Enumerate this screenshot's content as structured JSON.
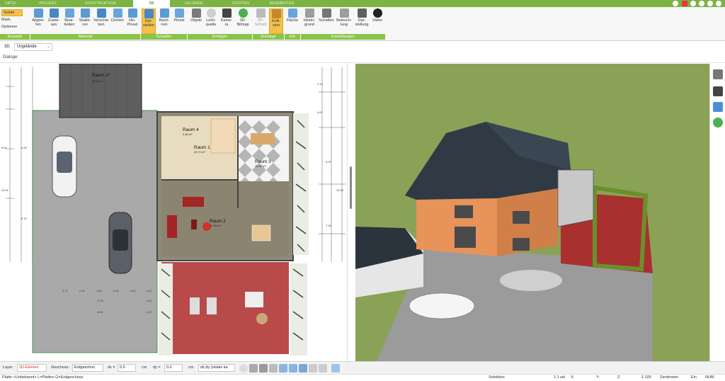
{
  "tabs": [
    {
      "label": "DATEI",
      "active": false
    },
    {
      "label": "PROJEKT",
      "active": false
    },
    {
      "label": "KONSTRUKTION",
      "active": false
    },
    {
      "label": "3D",
      "active": true
    },
    {
      "label": "GELÄNDE",
      "active": false
    },
    {
      "label": "SICHTEN",
      "active": false
    },
    {
      "label": "BEARBEITEN",
      "active": false
    }
  ],
  "ribbon": {
    "selection": {
      "select": "Selekt",
      "mark": "Mark.",
      "options": "Optionen"
    },
    "buttons": {
      "abgreifen": "Abgrei-\nfen",
      "zuweisen": "Zuwei-\nsen",
      "bearbeiten": "Bear-\nbeiten",
      "skalieren": "Skalie-\nren",
      "verschieben": "Verschie-\nben",
      "drehen": "Drehen",
      "hinpinsel": "Hin.\nPinsel",
      "darstellen": "Dar-\nstellen",
      "rechnen": "Rech-\nnen",
      "pinsel": "Pinsel",
      "objekt": "Objekt",
      "lichtquelle": "Licht-\nquelle",
      "kamera": "Kame-\nra",
      "bitmap": "3D-\nBitmap",
      "schnitt": "3D-\nSchnitt",
      "kollision": "Kolli-\nsion",
      "flaeche": "Fläche",
      "hintergrund": "Hinter-\ngrund",
      "schatten": "Schatten",
      "beleuchtung": "Beleuch-\ntung",
      "darstellung": "Dar-\nstellung",
      "video": "Video"
    },
    "groups": {
      "auswahl": "Auswahl",
      "material": "Material",
      "schatten": "Schatten",
      "einfuegen": "Einfügen",
      "sonstige": "Sonstige",
      "info": "Info",
      "einstellungen": "Einstellungen"
    }
  },
  "subbar": {
    "mode": "3D",
    "terrain": "Urgelände",
    "dialog_label": "Dialoge:"
  },
  "plan": {
    "rooms": [
      {
        "name": "Raum 2*",
        "area": "26.60 m²"
      },
      {
        "name": "Raum 4",
        "area": "3.46 m²"
      },
      {
        "name": "Raum 1",
        "area": "20.71 m²"
      },
      {
        "name": "Raum 3",
        "area": "16.57 m²"
      },
      {
        "name": "Raum 2",
        "area": "31.69 m²"
      }
    ],
    "dims_left": [
      "6.01",
      "4.99",
      "10.51",
      "5.76"
    ],
    "dims_right": [
      "4.14",
      "4.67",
      "6.97",
      "11.98",
      "7.02"
    ],
    "dims_bottom_row1": [
      "2.71",
      "2.01",
      "1.51",
      "2.31",
      "2.01",
      "1.13"
    ],
    "dims_bottom_row2": [
      "9.76",
      "1.13"
    ],
    "dims_bottom_row3": [
      "8.02",
      "1.13"
    ]
  },
  "statusbar": {
    "layer_label": "Layer :",
    "layer_value": "2D-Elemen",
    "geschoss_label": "Geschoss :",
    "geschoss_value": "Erdgeschos",
    "dx_label": "dx =",
    "dx_value": "0.0",
    "dx_unit": "cm",
    "dy_label": "dy =",
    "dy_value": "0.0",
    "dy_unit": "cm",
    "mode_value": "dx,dy (relativ ka"
  },
  "infobar": {
    "left": "Platte <Unbekannt> L=Platten G=Erdgeschoss",
    "selektion": "Selektion",
    "ratio": "1:1 sel",
    "x": "X:",
    "y": "Y:",
    "z": "Z:",
    "scale": "1:100",
    "unit": "Zentimeter",
    "ein": "Ein",
    "num": "NUM"
  },
  "colors": {
    "ribbon_green": "#7cb342",
    "group_green": "#8bc34a",
    "active_yellow": "#f3c14b",
    "grass": "#8da55a",
    "roof": "#2f3a45",
    "walls": "#e8955a",
    "terrace": "#b33a3a",
    "driveway": "#9a9a9a"
  }
}
